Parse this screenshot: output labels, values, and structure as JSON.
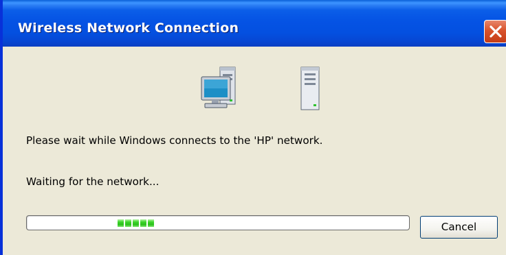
{
  "window": {
    "title": "Wireless Network Connection",
    "close_icon": "close-icon"
  },
  "icons": {
    "computer": "computer-icon",
    "network": "network-server-icon"
  },
  "message": "Please wait while Windows connects to the 'HP' network.",
  "status": "Waiting for the network...",
  "progress": {
    "mode": "indeterminate (marquee)",
    "chunk_count": 5,
    "chunk_color": "#2cc01c"
  },
  "buttons": {
    "cancel_label": "Cancel"
  },
  "colors": {
    "titlebar": "#0553e4",
    "background": "#ece9d8",
    "close_button": "#d9532c"
  }
}
